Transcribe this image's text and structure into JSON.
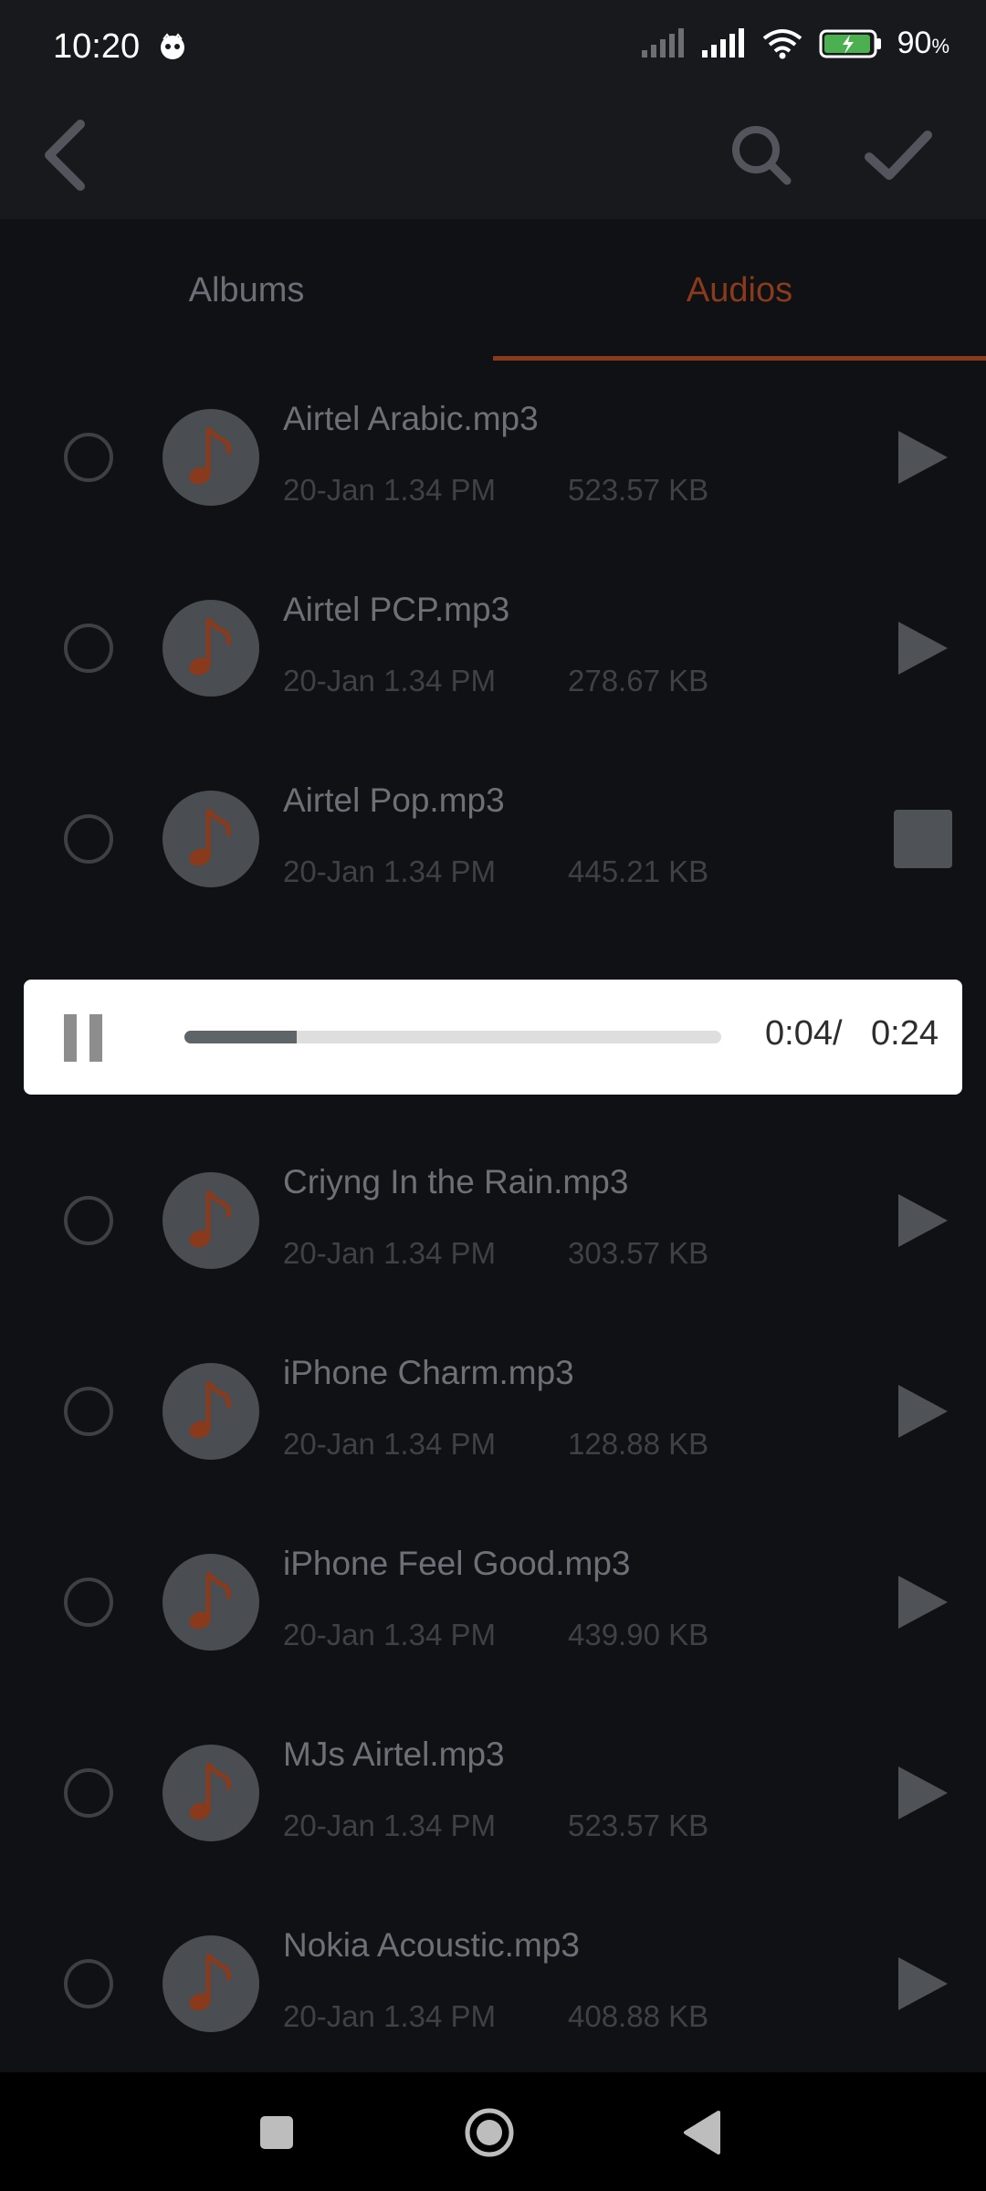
{
  "status_bar": {
    "time": "10:20",
    "battery_percent": "90",
    "percent_sign": "%"
  },
  "toolbar": {
    "back_icon": "chevron-left-icon",
    "search_icon": "search-icon",
    "confirm_icon": "check-icon"
  },
  "tabs": [
    {
      "label": "Albums",
      "active": false
    },
    {
      "label": "Audios",
      "active": true
    }
  ],
  "audio_list": [
    {
      "title": "Airtel Arabic.mp3",
      "date": "20-Jan 1.34 PM",
      "size": "523.57 KB",
      "action": "play"
    },
    {
      "title": "Airtel PCP.mp3",
      "date": "20-Jan 1.34 PM",
      "size": "278.67 KB",
      "action": "play"
    },
    {
      "title": "Airtel Pop.mp3",
      "date": "20-Jan 1.34 PM",
      "size": "445.21 KB",
      "action": "stop"
    },
    {
      "title": "Criyng In the Rain.mp3",
      "date": "20-Jan 1.34 PM",
      "size": "303.57 KB",
      "action": "play"
    },
    {
      "title": "iPhone Charm.mp3",
      "date": "20-Jan 1.34 PM",
      "size": "128.88 KB",
      "action": "play"
    },
    {
      "title": "iPhone Feel Good.mp3",
      "date": "20-Jan 1.34 PM",
      "size": "439.90 KB",
      "action": "play"
    },
    {
      "title": "MJs Airtel.mp3",
      "date": "20-Jan 1.34 PM",
      "size": "523.57 KB",
      "action": "play"
    },
    {
      "title": "Nokia Acoustic.mp3",
      "date": "20-Jan 1.34 PM",
      "size": "408.88 KB",
      "action": "play"
    }
  ],
  "player": {
    "current_time": "0:04/",
    "total_time": "0:24",
    "progress": 0.21
  },
  "colors": {
    "accent": "#8a3a1c",
    "background": "#0f1114",
    "toolbar": "#17191c"
  },
  "nav_bar": {
    "recents_icon": "square-icon",
    "home_icon": "circle-icon",
    "back_icon": "triangle-back-icon"
  }
}
